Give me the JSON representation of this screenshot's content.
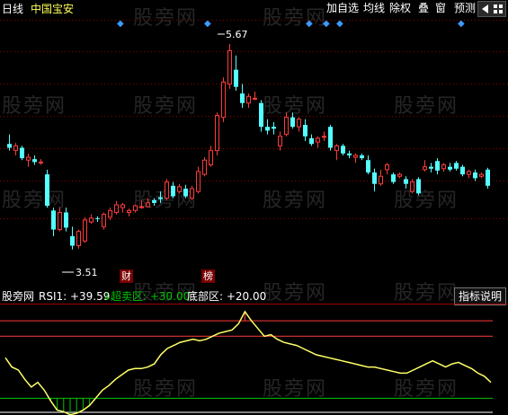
{
  "header": {
    "period": "日线",
    "stock_name": "中国宝安"
  },
  "toolbar": {
    "items": [
      "加自选",
      "均线",
      "除权",
      "叠",
      "窗",
      "预测"
    ]
  },
  "nav": {
    "back_icon": "triangle-left-icon",
    "menu_icon": "grid-icon"
  },
  "watermark": "股旁网",
  "price": {
    "high_label": "5.67",
    "low_label": "3.51"
  },
  "markers": {
    "cai": "财",
    "bang": "榜"
  },
  "indicator": {
    "name": "股旁网",
    "rsi_label": "RSI1: +39.59",
    "rsi_arrow": "↓",
    "overbought_label": "超卖区: +30.00",
    "bottom_label": "底部区: +20.00",
    "explain_button": "指标说明"
  },
  "colors": {
    "up": "#ff3b3b",
    "down": "#54ffff",
    "rsi": "#ffff66",
    "overbought": "#ff3b3b",
    "bottom": "#ffffff",
    "green": "#00c400",
    "marker": "#3b9cff"
  },
  "chart_data": [
    {
      "type": "candlestick",
      "title": "",
      "ylim": [
        3.3,
        5.85
      ],
      "series": [
        {
          "o": 4.62,
          "h": 4.72,
          "l": 4.55,
          "c": 4.58
        },
        {
          "o": 4.55,
          "h": 4.63,
          "l": 4.5,
          "c": 4.6
        },
        {
          "o": 4.58,
          "h": 4.6,
          "l": 4.45,
          "c": 4.47
        },
        {
          "o": 4.45,
          "h": 4.52,
          "l": 4.38,
          "c": 4.48
        },
        {
          "o": 4.46,
          "h": 4.5,
          "l": 4.4,
          "c": 4.43
        },
        {
          "o": 4.42,
          "h": 4.46,
          "l": 4.4,
          "c": 4.43
        },
        {
          "o": 4.3,
          "h": 4.35,
          "l": 3.95,
          "c": 3.97
        },
        {
          "o": 3.92,
          "h": 3.95,
          "l": 3.65,
          "c": 3.72
        },
        {
          "o": 3.72,
          "h": 3.95,
          "l": 3.7,
          "c": 3.9
        },
        {
          "o": 3.9,
          "h": 3.95,
          "l": 3.7,
          "c": 3.74
        },
        {
          "o": 3.65,
          "h": 3.75,
          "l": 3.51,
          "c": 3.55
        },
        {
          "o": 3.55,
          "h": 3.72,
          "l": 3.52,
          "c": 3.7
        },
        {
          "o": 3.6,
          "h": 3.85,
          "l": 3.58,
          "c": 3.82
        },
        {
          "o": 3.8,
          "h": 3.88,
          "l": 3.78,
          "c": 3.84
        },
        {
          "o": 3.84,
          "h": 3.86,
          "l": 3.8,
          "c": 3.83
        },
        {
          "o": 3.75,
          "h": 3.9,
          "l": 3.72,
          "c": 3.88
        },
        {
          "o": 3.85,
          "h": 3.95,
          "l": 3.82,
          "c": 3.92
        },
        {
          "o": 3.9,
          "h": 4.02,
          "l": 3.88,
          "c": 3.98
        },
        {
          "o": 3.95,
          "h": 4.0,
          "l": 3.9,
          "c": 3.98
        },
        {
          "o": 3.9,
          "h": 3.94,
          "l": 3.86,
          "c": 3.92
        },
        {
          "o": 3.92,
          "h": 3.98,
          "l": 3.9,
          "c": 3.97
        },
        {
          "o": 3.96,
          "h": 4.03,
          "l": 3.94,
          "c": 3.96
        },
        {
          "o": 3.96,
          "h": 4.05,
          "l": 3.95,
          "c": 4.0
        },
        {
          "o": 4.03,
          "h": 4.05,
          "l": 3.97,
          "c": 4.0
        },
        {
          "o": 4.06,
          "h": 4.12,
          "l": 4.0,
          "c": 4.04
        },
        {
          "o": 4.05,
          "h": 4.25,
          "l": 4.03,
          "c": 4.22
        },
        {
          "o": 4.18,
          "h": 4.22,
          "l": 4.05,
          "c": 4.07
        },
        {
          "o": 4.12,
          "h": 4.2,
          "l": 4.1,
          "c": 4.17
        },
        {
          "o": 4.15,
          "h": 4.19,
          "l": 4.05,
          "c": 4.07
        },
        {
          "o": 4.05,
          "h": 4.18,
          "l": 4.03,
          "c": 4.15
        },
        {
          "o": 4.12,
          "h": 4.38,
          "l": 4.1,
          "c": 4.33
        },
        {
          "o": 4.3,
          "h": 4.48,
          "l": 4.28,
          "c": 4.45
        },
        {
          "o": 4.4,
          "h": 4.6,
          "l": 4.38,
          "c": 4.55
        },
        {
          "o": 4.55,
          "h": 4.95,
          "l": 4.5,
          "c": 4.92
        },
        {
          "o": 4.9,
          "h": 5.32,
          "l": 4.85,
          "c": 5.27
        },
        {
          "o": 5.25,
          "h": 5.67,
          "l": 5.2,
          "c": 5.6
        },
        {
          "o": 5.4,
          "h": 5.55,
          "l": 5.18,
          "c": 5.22
        },
        {
          "o": 5.15,
          "h": 5.25,
          "l": 5.0,
          "c": 5.05
        },
        {
          "o": 5.05,
          "h": 5.15,
          "l": 5.0,
          "c": 5.12
        },
        {
          "o": 5.1,
          "h": 5.17,
          "l": 5.08,
          "c": 5.1
        },
        {
          "o": 5.05,
          "h": 5.08,
          "l": 4.75,
          "c": 4.8
        },
        {
          "o": 4.8,
          "h": 4.88,
          "l": 4.72,
          "c": 4.76
        },
        {
          "o": 4.8,
          "h": 4.85,
          "l": 4.72,
          "c": 4.78
        },
        {
          "o": 4.6,
          "h": 4.75,
          "l": 4.55,
          "c": 4.7
        },
        {
          "o": 4.72,
          "h": 4.95,
          "l": 4.7,
          "c": 4.9
        },
        {
          "o": 4.9,
          "h": 4.95,
          "l": 4.78,
          "c": 4.8
        },
        {
          "o": 4.8,
          "h": 4.9,
          "l": 4.75,
          "c": 4.88
        },
        {
          "o": 4.82,
          "h": 4.88,
          "l": 4.65,
          "c": 4.7
        },
        {
          "o": 4.68,
          "h": 4.72,
          "l": 4.6,
          "c": 4.62
        },
        {
          "o": 4.64,
          "h": 4.7,
          "l": 4.58,
          "c": 4.68
        },
        {
          "o": 4.7,
          "h": 4.75,
          "l": 4.65,
          "c": 4.7
        },
        {
          "o": 4.8,
          "h": 4.82,
          "l": 4.55,
          "c": 4.58
        },
        {
          "o": 4.55,
          "h": 4.62,
          "l": 4.45,
          "c": 4.6
        },
        {
          "o": 4.6,
          "h": 4.62,
          "l": 4.5,
          "c": 4.52
        },
        {
          "o": 4.52,
          "h": 4.55,
          "l": 4.47,
          "c": 4.5
        },
        {
          "o": 4.48,
          "h": 4.52,
          "l": 4.42,
          "c": 4.5
        },
        {
          "o": 4.5,
          "h": 4.52,
          "l": 4.45,
          "c": 4.47
        },
        {
          "o": 4.45,
          "h": 4.5,
          "l": 4.3,
          "c": 4.32
        },
        {
          "o": 4.32,
          "h": 4.36,
          "l": 4.12,
          "c": 4.2
        },
        {
          "o": 4.2,
          "h": 4.35,
          "l": 4.18,
          "c": 4.28
        },
        {
          "o": 4.35,
          "h": 4.42,
          "l": 4.3,
          "c": 4.4
        },
        {
          "o": 4.3,
          "h": 4.32,
          "l": 4.2,
          "c": 4.22
        },
        {
          "o": 4.28,
          "h": 4.32,
          "l": 4.26,
          "c": 4.3
        },
        {
          "o": 4.25,
          "h": 4.28,
          "l": 4.15,
          "c": 4.2
        },
        {
          "o": 4.12,
          "h": 4.25,
          "l": 4.1,
          "c": 4.22
        },
        {
          "o": 4.25,
          "h": 4.27,
          "l": 4.08,
          "c": 4.1
        },
        {
          "o": 4.35,
          "h": 4.45,
          "l": 4.33,
          "c": 4.38
        },
        {
          "o": 4.38,
          "h": 4.42,
          "l": 4.32,
          "c": 4.36
        },
        {
          "o": 4.44,
          "h": 4.47,
          "l": 4.3,
          "c": 4.34
        },
        {
          "o": 4.36,
          "h": 4.42,
          "l": 4.33,
          "c": 4.4
        },
        {
          "o": 4.38,
          "h": 4.42,
          "l": 4.33,
          "c": 4.35
        },
        {
          "o": 4.42,
          "h": 4.44,
          "l": 4.34,
          "c": 4.36
        },
        {
          "o": 4.38,
          "h": 4.4,
          "l": 4.28,
          "c": 4.3
        },
        {
          "o": 4.3,
          "h": 4.35,
          "l": 4.26,
          "c": 4.33
        },
        {
          "o": 4.32,
          "h": 4.35,
          "l": 4.23,
          "c": 4.26
        },
        {
          "o": 4.28,
          "h": 4.32,
          "l": 4.26,
          "c": 4.3
        },
        {
          "o": 4.35,
          "h": 4.37,
          "l": 4.15,
          "c": 4.18
        }
      ]
    },
    {
      "type": "line",
      "title": "",
      "ylim": [
        20,
        90
      ],
      "series": [
        {
          "name": "RSI1",
          "values": [
            56,
            50,
            48,
            42,
            37,
            40,
            35,
            28,
            22,
            21,
            19,
            20,
            22,
            25,
            30,
            35,
            38,
            42,
            45,
            48,
            49,
            49,
            50,
            52,
            58,
            62,
            64,
            66,
            67,
            68,
            67,
            68,
            70,
            72,
            73,
            74,
            78,
            86,
            80,
            75,
            70,
            71,
            68,
            66,
            65,
            64,
            62,
            60,
            58,
            57,
            56,
            55,
            54,
            53,
            52,
            51,
            50,
            50,
            49,
            48,
            47,
            46,
            46,
            48,
            50,
            52,
            54,
            52,
            50,
            52,
            53,
            51,
            49,
            46,
            44,
            40
          ]
        }
      ],
      "levels": [
        {
          "value": 30
        },
        {
          "value": 20
        }
      ]
    }
  ]
}
